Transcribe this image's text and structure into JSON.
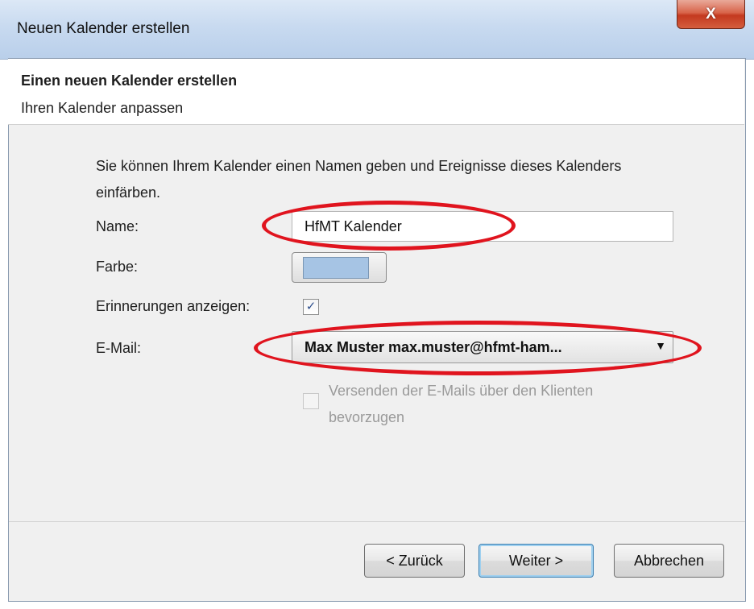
{
  "window": {
    "title": "Neuen Kalender erstellen",
    "close_glyph": "X"
  },
  "header": {
    "title": "Einen neuen Kalender erstellen",
    "subtitle": "Ihren Kalender anpassen"
  },
  "intro_text": "Sie können Ihrem Kalender einen Namen geben und Ereignisse dieses Kalenders einfärben.",
  "form": {
    "name_label": "Name:",
    "name_value": "HfMT Kalender",
    "color_label": "Farbe:",
    "color_value": "#a6c4e4",
    "reminders_label": "Erinnerungen anzeigen:",
    "reminders_checked": true,
    "email_label": "E-Mail:",
    "email_value": "Max Muster max.muster@hfmt-ham...",
    "client_mail_label": "Versenden der E-Mails über den Klienten bevorzugen",
    "client_mail_checked": false
  },
  "buttons": {
    "back": "< Zurück",
    "next": "Weiter >",
    "cancel": "Abbrechen"
  },
  "annotation_color": "#e0141e"
}
